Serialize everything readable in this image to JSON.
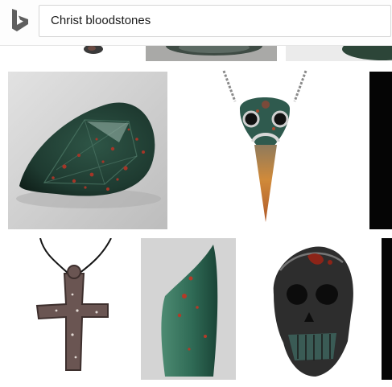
{
  "search": {
    "query": "Christ bloodstones"
  },
  "logo": {
    "icon": "bing-logo-icon",
    "color": "#5f5f5f"
  },
  "results": [
    {
      "subject": "partially-visible-top-left",
      "row": 0
    },
    {
      "subject": "partially-visible-top-middle",
      "row": 0
    },
    {
      "subject": "partially-visible-top-right",
      "row": 0
    },
    {
      "subject": "pear-cut-bloodstone-gem",
      "row": 1
    },
    {
      "subject": "bloodstone-bird-skull-pendant",
      "row": 1
    },
    {
      "subject": "partially-visible-black-right",
      "row": 1
    },
    {
      "subject": "bloodstone-cross-pendant",
      "row": 2
    },
    {
      "subject": "bloodstone-horn-cabochon",
      "row": 2
    },
    {
      "subject": "bloodstone-skull-carving",
      "row": 2
    },
    {
      "subject": "partially-visible-black-right-2",
      "row": 2
    }
  ],
  "colors": {
    "bloodstone_green": "#23473a",
    "blood_red": "#9b2a1e",
    "gem_background": "#cfcfcf"
  }
}
